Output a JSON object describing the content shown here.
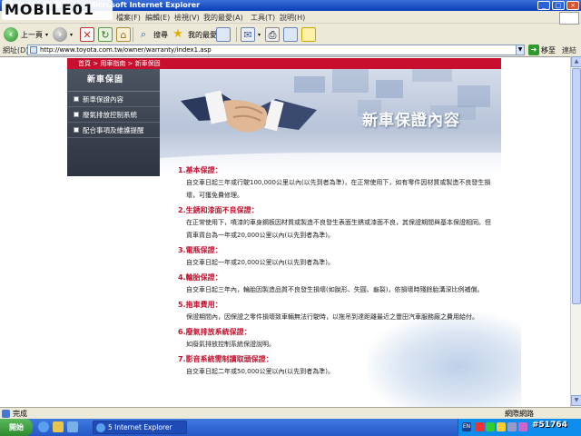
{
  "window": {
    "title": "TOYOTA 國 際 網 站 - Microsoft Internet Explorer",
    "logo_text": "MOBILE01",
    "controls": [
      "_",
      "□",
      "×"
    ]
  },
  "menu": [
    "檔案(F)",
    "編輯(E)",
    "檢視(V)",
    "我的最愛(A)",
    "工具(T)",
    "說明(H)"
  ],
  "toolbar": {
    "back_label": "上一頁",
    "search_label": "搜尋",
    "favorites_label": "我的最愛"
  },
  "address": {
    "label": "網址(D)",
    "url": "http://www.toyota.com.tw/owner/warranty/index1.asp",
    "go_label": "移至",
    "links_label": "連結"
  },
  "site": {
    "breadcrumb": "首頁 > 用車指南 > 新車保固",
    "banner_title": "新車保證內容",
    "sidebar": {
      "heading": "新車保固",
      "items": [
        "新車保證內容",
        "廢氣排放控制系統",
        "配合事項及維護提醒"
      ]
    },
    "sections": [
      {
        "title": "1.基本保證：",
        "body": "自交車日起三年或行駛100,000公里以內(以先到者為準)，在正常使用下，如有零件因材質或製造不良發生損壞，可獲免費修理。"
      },
      {
        "title": "2.生銹和漆面不良保證：",
        "body": "在正常使用下，噴漆的車身鋼板因材質或製造不良發生表面生銹或漆面不良，其保證期間與基本保證相同。但貨車貨台為一年或20,000公里以內(以先到者為準)。"
      },
      {
        "title": "3.電瓶保證：",
        "body": "自交車日起一年或20,000公里以內(以先到者為準)。"
      },
      {
        "title": "4.輪胎保證：",
        "body": "自交車日起三年內，輪胎因製造品質不良發生損壞(如脫形、失圓、龜裂)，依損壞時殘餘胎溝深比例補償。"
      },
      {
        "title": "5.拖車費用：",
        "body": "保證期間內，因保證之零件損壞致車輛無法行駛時，以拖吊到達距離最近之豐田汽車服務廠之費用給付。"
      },
      {
        "title": "6.廢氣排放系統保證：",
        "body": "如廢氣排放控制系統保證說明。"
      },
      {
        "title": "7.影音系統需制讀取頭保證：",
        "body": "自交車日起二年或50,000公里以內(以先到者為準)。"
      }
    ]
  },
  "status": {
    "text": "完成",
    "zone": "網際網路"
  },
  "taskbar": {
    "start_label": "開始",
    "task_label": "5 Internet Explorer",
    "watermark": "#51764"
  },
  "colors": {
    "brand_red": "#c8102e",
    "sidebar_dark": "#3a414e",
    "xp_blue": "#2457c8"
  }
}
